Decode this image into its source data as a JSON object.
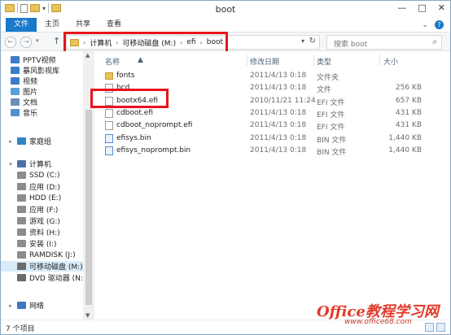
{
  "window": {
    "title": "boot",
    "minimize": "—",
    "maximize": "□",
    "close": "✕"
  },
  "ribbon": {
    "tabs": [
      "文件",
      "主页",
      "共享",
      "查看"
    ],
    "expand": "⌄"
  },
  "nav": {
    "back": "←",
    "forward": "→",
    "dropdown": "▾",
    "up": "↑",
    "address": [
      "计算机",
      "可移动磁盘 (M:)",
      "efi",
      "boot"
    ],
    "address_chev": "›",
    "address_dropdown": "▾",
    "refresh": "↻",
    "search_placeholder": "搜索 boot",
    "search_icon": "⌕"
  },
  "sidebar": {
    "expand_open": "▾",
    "expand_closed": "▸",
    "items": [
      {
        "label": "PPTV视频",
        "icon": "video-library-icon",
        "color": "#3d7cc9"
      },
      {
        "label": "暴风影视库",
        "icon": "video-library-icon",
        "color": "#3d7cc9"
      },
      {
        "label": "视频",
        "icon": "video-library-icon",
        "color": "#3d7cc9"
      },
      {
        "label": "图片",
        "icon": "pictures-library-icon",
        "color": "#5aa0d8"
      },
      {
        "label": "文档",
        "icon": "documents-library-icon",
        "color": "#6a8fb8"
      },
      {
        "label": "音乐",
        "icon": "music-library-icon",
        "color": "#4f8fcf"
      },
      {
        "label": "家庭组",
        "icon": "homegroup-icon",
        "color": "#2d86c8"
      },
      {
        "label": "计算机",
        "icon": "computer-icon",
        "color": "#4a74a8"
      },
      {
        "label": "SSD (C:)",
        "icon": "drive-icon",
        "color": "#8c8c8c"
      },
      {
        "label": "应用 (D:)",
        "icon": "drive-icon",
        "color": "#8c8c8c"
      },
      {
        "label": "HDD (E:)",
        "icon": "drive-icon",
        "color": "#8c8c8c"
      },
      {
        "label": "应用 (F:)",
        "icon": "drive-icon",
        "color": "#8c8c8c"
      },
      {
        "label": "游戏 (G:)",
        "icon": "drive-icon",
        "color": "#8c8c8c"
      },
      {
        "label": "资料 (H:)",
        "icon": "drive-icon",
        "color": "#8c8c8c"
      },
      {
        "label": "安装 (I:)",
        "icon": "drive-icon",
        "color": "#8c8c8c"
      },
      {
        "label": "RAMDISK (J:)",
        "icon": "drive-icon",
        "color": "#8c8c8c"
      },
      {
        "label": "可移动磁盘 (M:)",
        "icon": "removable-drive-icon",
        "color": "#6b6b6b"
      },
      {
        "label": "DVD 驱动器 (N:)",
        "icon": "dvd-drive-icon",
        "color": "#6b6b6b"
      },
      {
        "label": "网络",
        "icon": "network-icon",
        "color": "#3a78c0"
      }
    ]
  },
  "columns": {
    "name": "名称",
    "date": "修改日期",
    "type": "类型",
    "size": "大小",
    "sort_indicator": "▲"
  },
  "files": [
    {
      "name": "fonts",
      "date": "2011/4/13 0:18",
      "type": "文件夹",
      "size": "",
      "icon": "folder-icon"
    },
    {
      "name": "bcd",
      "date": "2011/4/13 0:18",
      "type": "文件",
      "size": "256 KB",
      "icon": "file-icon"
    },
    {
      "name": "bootx64.efi",
      "date": "2010/11/21 11:24",
      "type": "EFI 文件",
      "size": "657 KB",
      "icon": "file-icon"
    },
    {
      "name": "cdboot.efi",
      "date": "2011/4/13 0:18",
      "type": "EFI 文件",
      "size": "431 KB",
      "icon": "file-icon"
    },
    {
      "name": "cdboot_noprompt.efi",
      "date": "2011/4/13 0:18",
      "type": "EFI 文件",
      "size": "431 KB",
      "icon": "file-icon"
    },
    {
      "name": "efisys.bin",
      "date": "2011/4/13 0:18",
      "type": "BIN 文件",
      "size": "1,440 KB",
      "icon": "bin-file-icon"
    },
    {
      "name": "efisys_noprompt.bin",
      "date": "2011/4/13 0:18",
      "type": "BIN 文件",
      "size": "1,440 KB",
      "icon": "bin-file-icon"
    }
  ],
  "status": {
    "count": "7 个项目"
  },
  "watermark": {
    "brand": "Office教程学习网",
    "url": "www.office68.com"
  },
  "colors": {
    "accent": "#1979ca",
    "highlight": "#e8141b",
    "selection": "#d9ebf9"
  }
}
